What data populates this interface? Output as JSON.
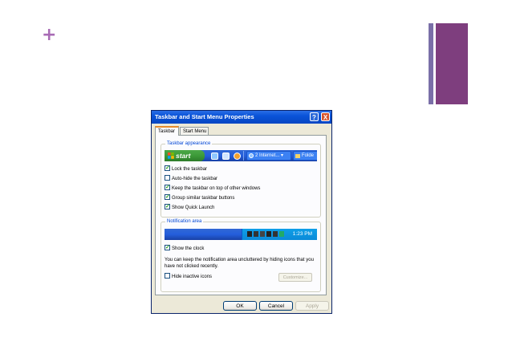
{
  "slide": {
    "plus_glyph": "+",
    "accent_color": "#7e3e7e"
  },
  "dialog": {
    "title": "Taskbar and Start Menu Properties",
    "help_glyph": "?",
    "close_glyph": "X",
    "tabs": [
      {
        "label": "Taskbar",
        "active": true
      },
      {
        "label": "Start Menu",
        "active": false
      }
    ],
    "taskbar_group": {
      "label": "Taskbar appearance",
      "preview": {
        "start_label": "start",
        "task_button_1": "2 Internet...",
        "task_button_1_arrow": "▾",
        "task_button_2": "Folde"
      },
      "options": [
        {
          "label": "Lock the taskbar",
          "checked": true
        },
        {
          "label": "Auto-hide the taskbar",
          "checked": false
        },
        {
          "label": "Keep the taskbar on top of other windows",
          "checked": true
        },
        {
          "label": "Group similar taskbar buttons",
          "checked": true
        },
        {
          "label": "Show Quick Launch",
          "checked": true
        }
      ]
    },
    "notification_group": {
      "label": "Notification area",
      "clock_time": "1:23 PM",
      "show_clock": {
        "label": "Show the clock",
        "checked": true
      },
      "description": "You can keep the notification area uncluttered by hiding icons that you have not clicked recently.",
      "hide_inactive": {
        "label": "Hide inactive icons",
        "checked": false
      },
      "customize_label": "Customize..."
    },
    "buttons": {
      "ok": "OK",
      "cancel": "Cancel",
      "apply": "Apply"
    }
  }
}
